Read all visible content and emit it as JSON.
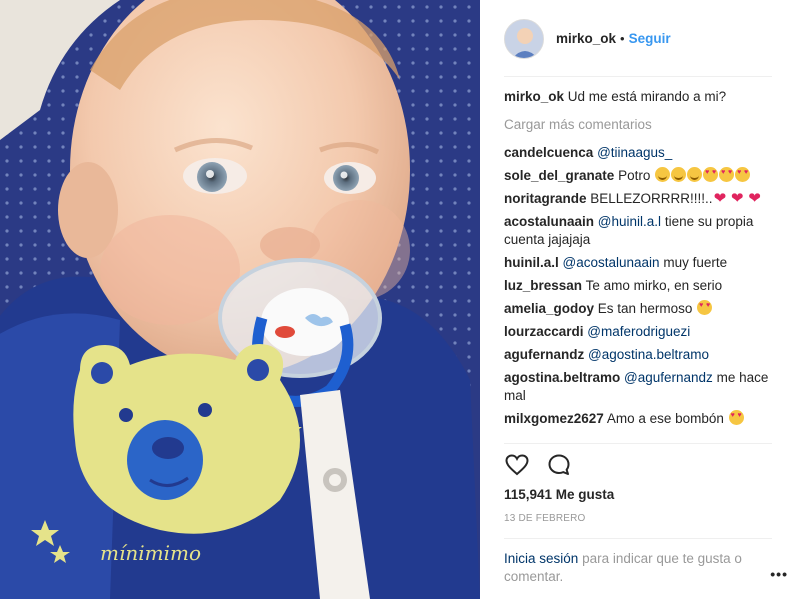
{
  "post": {
    "photo_alt": "",
    "photo_print": "mínimimo"
  },
  "header": {
    "username": "mirko_ok",
    "separator": "•",
    "follow_label": "Seguir"
  },
  "caption": {
    "user": "mirko_ok",
    "text": "Ud me está mirando a mi?"
  },
  "load_more_label": "Cargar más comentarios",
  "comments": [
    {
      "user": "candelcuenca",
      "mention": "@tiinaagus_",
      "text": ""
    },
    {
      "user": "sole_del_granate",
      "mention": "",
      "text": "Potro"
    },
    {
      "user": "noritagrande",
      "mention": "",
      "text": "BELLEZORRRR!!!!.."
    },
    {
      "user": "acostalunaain",
      "mention": "@huinil.a.l",
      "text": "tiene su propia cuenta jajajaja"
    },
    {
      "user": "huinil.a.l",
      "mention": "@acostalunaain",
      "text": "muy fuerte"
    },
    {
      "user": "luz_bressan",
      "mention": "",
      "text": "Te amo mirko, en serio"
    },
    {
      "user": "amelia_godoy",
      "mention": "",
      "text": "Es tan hermoso"
    },
    {
      "user": "lourzaccardi",
      "mention": "@maferodriguezi",
      "text": ""
    },
    {
      "user": "agufernandz",
      "mention": "@agostina.beltramo",
      "text": ""
    },
    {
      "user": "agostina.beltramo",
      "mention": "@agufernandz",
      "text": "me hace mal"
    },
    {
      "user": "milxgomez2627",
      "mention": "",
      "text": "Amo a ese bombón"
    }
  ],
  "icons": {
    "like": "heart-outline-icon",
    "comment": "speech-bubble-icon",
    "more": "more-options-icon"
  },
  "likes_label": "115,941 Me gusta",
  "date_label": "13 DE FEBRERO",
  "login": {
    "link_label": "Inicia sesión",
    "text": "para indicar que te gusta o comentar."
  },
  "more_label": "•••",
  "colors": {
    "link_blue": "#3897f0",
    "mention_blue": "#003569",
    "muted_gray": "#999999",
    "text": "#262626"
  }
}
